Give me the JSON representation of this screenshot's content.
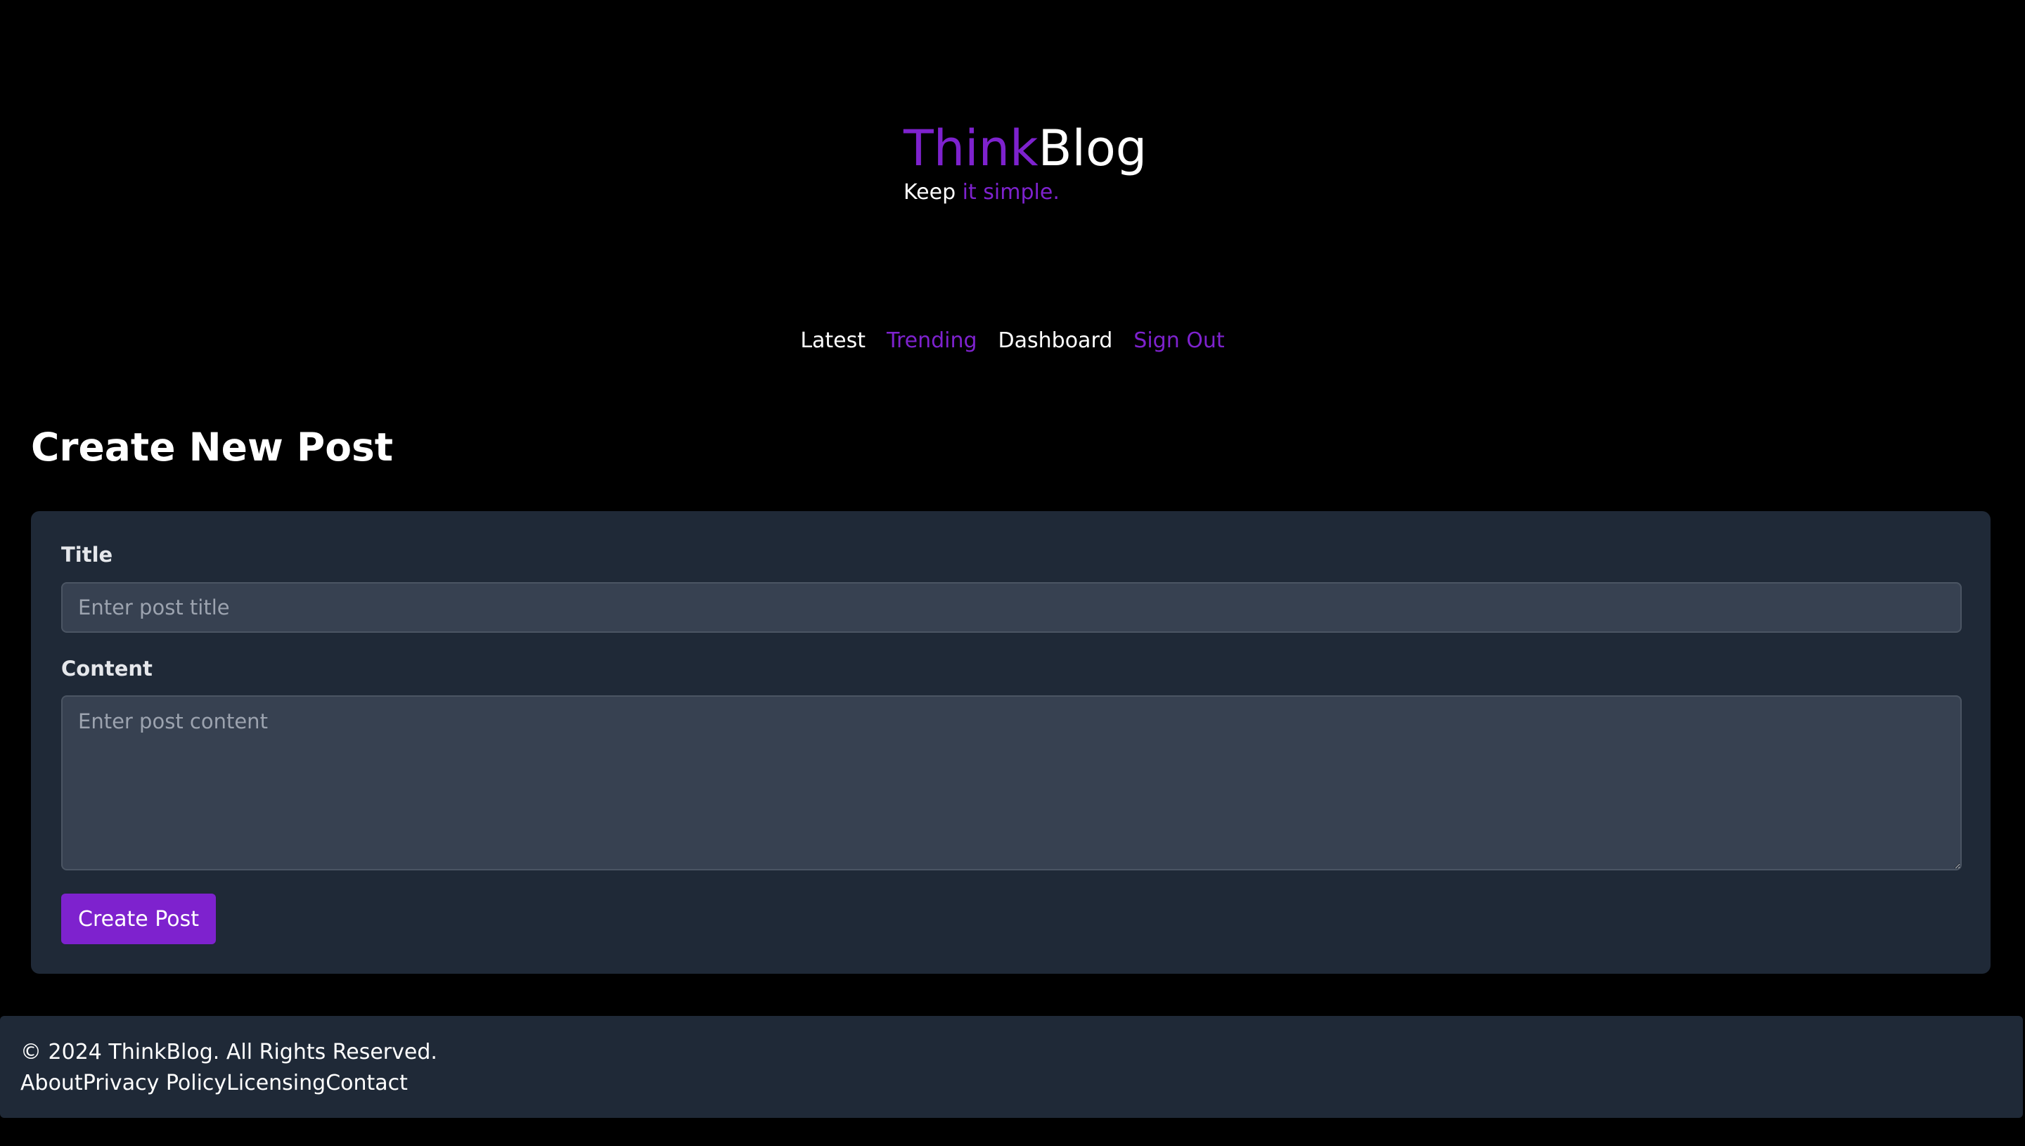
{
  "brand": {
    "logo_part1": "Think",
    "logo_part2": "Blog",
    "tagline_part1": "Keep ",
    "tagline_part2": "it simple."
  },
  "nav": {
    "items": [
      {
        "label": "Latest"
      },
      {
        "label": "Trending"
      },
      {
        "label": "Dashboard"
      },
      {
        "label": "Sign Out"
      }
    ]
  },
  "main": {
    "page_title": "Create New Post",
    "form": {
      "title_label": "Title",
      "title_placeholder": "Enter post title",
      "title_value": "",
      "content_label": "Content",
      "content_placeholder": "Enter post content",
      "content_value": "",
      "submit_label": "Create Post"
    }
  },
  "footer": {
    "copyright": "© 2024 ThinkBlog. All Rights Reserved.",
    "links": [
      {
        "label": "About"
      },
      {
        "label": "Privacy Policy"
      },
      {
        "label": "Licensing"
      },
      {
        "label": "Contact"
      }
    ]
  },
  "colors": {
    "background": "#000000",
    "accent": "#7e22ce",
    "card": "#1f2937",
    "input": "#374151",
    "text": "#ffffff",
    "placeholder": "#9ca3af"
  }
}
